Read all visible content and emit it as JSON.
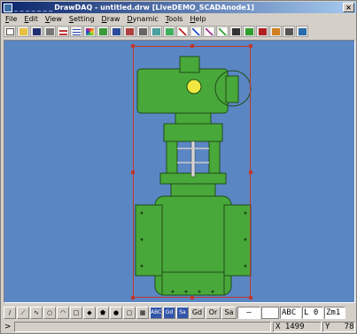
{
  "window": {
    "title_dots": "_ _ _ _ _ _ _",
    "title": "DrawDAQ - untitled.drw [LiveDEMO_SCADAnode1]",
    "minimize_label": "_",
    "maximize_label": "□",
    "close_label": "×"
  },
  "menu": {
    "items": [
      {
        "u": "F",
        "rest": "ile"
      },
      {
        "u": "E",
        "rest": "dit"
      },
      {
        "u": "V",
        "rest": "iew"
      },
      {
        "u": "S",
        "rest": "etting"
      },
      {
        "u": "D",
        "rest": "raw"
      },
      {
        "u": "D",
        "rest": "ynamic"
      },
      {
        "u": "T",
        "rest": "ools"
      },
      {
        "u": "H",
        "rest": "elp"
      }
    ]
  },
  "drawbar": {
    "txt_abc1": "ABC",
    "txt_gd": "Gd",
    "txt_sa": "Sa",
    "btn_gd": "Gd",
    "btn_or": "Or",
    "btn_sa": "Sa",
    "line_style": "—",
    "font_label": "ABC",
    "line_width": "L 0",
    "zoom_label": "Zm1"
  },
  "status": {
    "arrow": ">",
    "x_value": "X 1499",
    "y_value": "Y   78"
  },
  "colors": {
    "canvas_bg": "#5b86c4",
    "valve_green": "#49a83a",
    "selection": "#c0392b",
    "titlebar": "#0a246a"
  }
}
